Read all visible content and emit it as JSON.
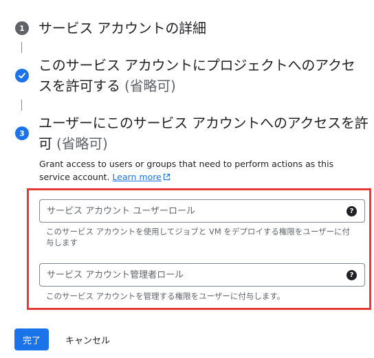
{
  "steps": [
    {
      "number": "1",
      "title": "サービス アカウントの詳細"
    },
    {
      "number": "check",
      "title": "このサービス アカウントにプロジェクトへのアクセスを許可する",
      "optional": "(省略可)"
    },
    {
      "number": "3",
      "title": "ユーザーにこのサービス アカウントへのアクセスを許可",
      "optional": "(省略可)"
    }
  ],
  "step3": {
    "description": "Grant access to users or groups that need to perform actions as this service account.",
    "learn_more": "Learn more",
    "user_role": {
      "placeholder": "サービス アカウント ユーザーロール",
      "value": "",
      "hint": "このサービス アカウントを使用してジョブと VM をデプロイする権限をユーザーに付与します"
    },
    "admin_role": {
      "placeholder": "サービス アカウント管理者ロール",
      "value": "",
      "hint": "このサービス アカウントを管理する権限をユーザーに付与します。"
    }
  },
  "actions": {
    "done": "完了",
    "cancel": "キャンセル"
  },
  "colors": {
    "primary": "#1a73e8",
    "highlight": "#e53935",
    "step_inactive": "#5f6368"
  }
}
